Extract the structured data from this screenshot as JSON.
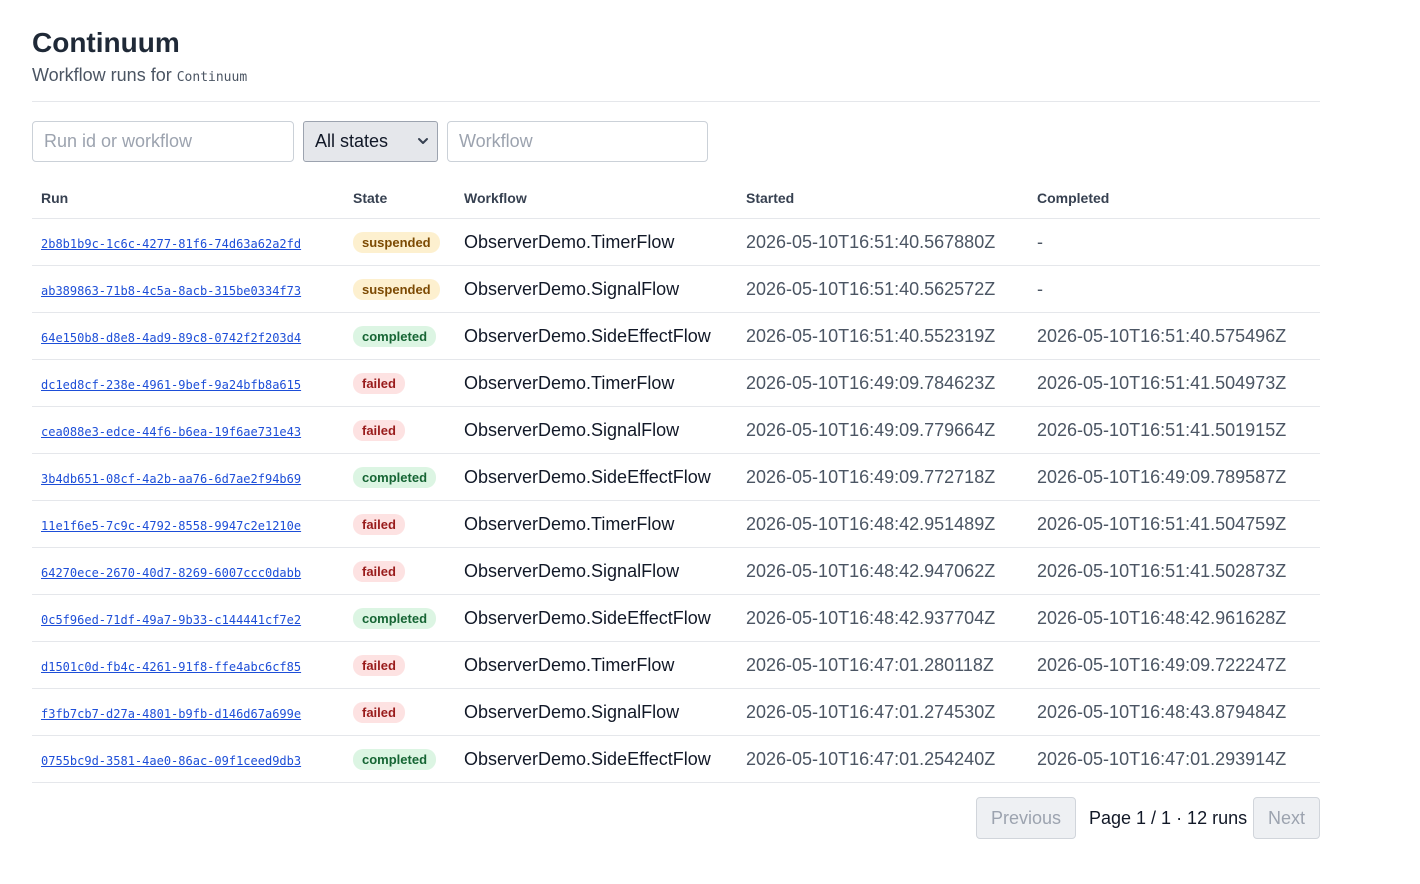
{
  "header": {
    "title": "Continuum",
    "subtitle_prefix": "Workflow runs for",
    "subtitle_code": "Continuum"
  },
  "filters": {
    "search_placeholder": "Run id or workflow",
    "state_selected": "All states",
    "workflow_placeholder": "Workflow"
  },
  "table": {
    "columns": [
      "Run",
      "State",
      "Workflow",
      "Started",
      "Completed"
    ],
    "rows": [
      {
        "run": "2b8b1b9c-1c6c-4277-81f6-74d63a62a2fd",
        "state": "suspended",
        "workflow": "ObserverDemo.TimerFlow",
        "started": "2026-05-10T16:51:40.567880Z",
        "completed": "-"
      },
      {
        "run": "ab389863-71b8-4c5a-8acb-315be0334f73",
        "state": "suspended",
        "workflow": "ObserverDemo.SignalFlow",
        "started": "2026-05-10T16:51:40.562572Z",
        "completed": "-"
      },
      {
        "run": "64e150b8-d8e8-4ad9-89c8-0742f2f203d4",
        "state": "completed",
        "workflow": "ObserverDemo.SideEffectFlow",
        "started": "2026-05-10T16:51:40.552319Z",
        "completed": "2026-05-10T16:51:40.575496Z"
      },
      {
        "run": "dc1ed8cf-238e-4961-9bef-9a24bfb8a615",
        "state": "failed",
        "workflow": "ObserverDemo.TimerFlow",
        "started": "2026-05-10T16:49:09.784623Z",
        "completed": "2026-05-10T16:51:41.504973Z"
      },
      {
        "run": "cea088e3-edce-44f6-b6ea-19f6ae731e43",
        "state": "failed",
        "workflow": "ObserverDemo.SignalFlow",
        "started": "2026-05-10T16:49:09.779664Z",
        "completed": "2026-05-10T16:51:41.501915Z"
      },
      {
        "run": "3b4db651-08cf-4a2b-aa76-6d7ae2f94b69",
        "state": "completed",
        "workflow": "ObserverDemo.SideEffectFlow",
        "started": "2026-05-10T16:49:09.772718Z",
        "completed": "2026-05-10T16:49:09.789587Z"
      },
      {
        "run": "11e1f6e5-7c9c-4792-8558-9947c2e1210e",
        "state": "failed",
        "workflow": "ObserverDemo.TimerFlow",
        "started": "2026-05-10T16:48:42.951489Z",
        "completed": "2026-05-10T16:51:41.504759Z"
      },
      {
        "run": "64270ece-2670-40d7-8269-6007ccc0dabb",
        "state": "failed",
        "workflow": "ObserverDemo.SignalFlow",
        "started": "2026-05-10T16:48:42.947062Z",
        "completed": "2026-05-10T16:51:41.502873Z"
      },
      {
        "run": "0c5f96ed-71df-49a7-9b33-c144441cf7e2",
        "state": "completed",
        "workflow": "ObserverDemo.SideEffectFlow",
        "started": "2026-05-10T16:48:42.937704Z",
        "completed": "2026-05-10T16:48:42.961628Z"
      },
      {
        "run": "d1501c0d-fb4c-4261-91f8-ffe4abc6cf85",
        "state": "failed",
        "workflow": "ObserverDemo.TimerFlow",
        "started": "2026-05-10T16:47:01.280118Z",
        "completed": "2026-05-10T16:49:09.722247Z"
      },
      {
        "run": "f3fb7cb7-d27a-4801-b9fb-d146d67a699e",
        "state": "failed",
        "workflow": "ObserverDemo.SignalFlow",
        "started": "2026-05-10T16:47:01.274530Z",
        "completed": "2026-05-10T16:48:43.879484Z"
      },
      {
        "run": "0755bc9d-3581-4ae0-86ac-09f1ceed9db3",
        "state": "completed",
        "workflow": "ObserverDemo.SideEffectFlow",
        "started": "2026-05-10T16:47:01.254240Z",
        "completed": "2026-05-10T16:47:01.293914Z"
      }
    ]
  },
  "pagination": {
    "prev_label": "Previous",
    "page_info": "Page 1 / 1 · 12 runs",
    "next_label": "Next"
  },
  "colors": {
    "link": "#1d4ed8",
    "suspended_bg": "#fdf0cf",
    "completed_bg": "#dcf5e3",
    "failed_bg": "#fde2e2"
  }
}
